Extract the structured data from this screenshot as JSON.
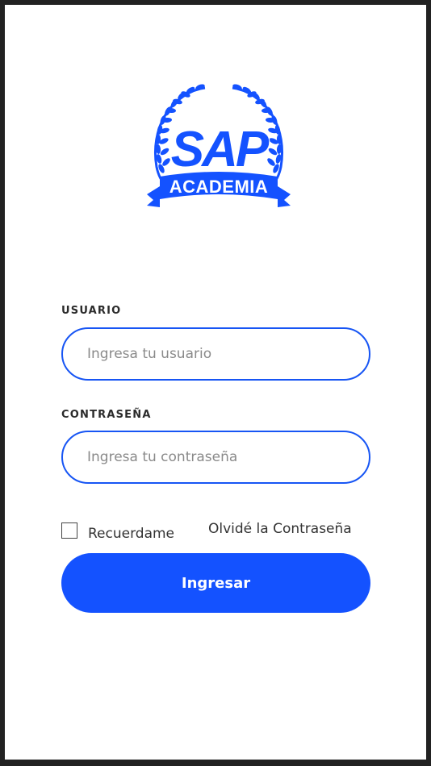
{
  "logo": {
    "title": "SAP",
    "subtitle": "ACADEMIA",
    "color": "#1452ff",
    "icon": "laurel-wreath-icon"
  },
  "form": {
    "user_label": "USUARIO",
    "user_placeholder": "Ingresa tu usuario",
    "user_value": "",
    "pass_label": "CONTRASEÑA",
    "pass_placeholder": "Ingresa tu contraseña",
    "pass_value": "",
    "remember_label": "Recuerdame",
    "remember_checked": false,
    "forgot_label": "Olvidé la Contraseña",
    "submit_label": "Ingresar"
  },
  "colors": {
    "accent": "#1452ff",
    "input_border": "#1755f4",
    "frame": "#222222",
    "background": "#ffffff"
  }
}
